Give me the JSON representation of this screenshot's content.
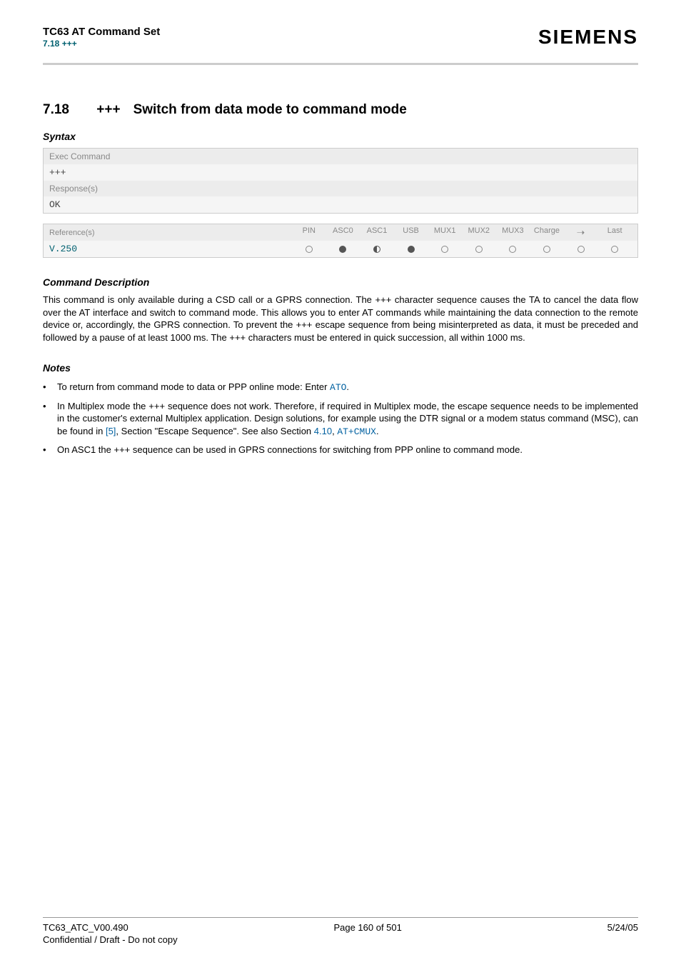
{
  "header": {
    "title": "TC63 AT Command Set",
    "sub": "7.18 +++",
    "brand": "SIEMENS"
  },
  "section": {
    "num": "7.18",
    "plus": "+++",
    "title": "Switch from data mode to command mode"
  },
  "syntax": {
    "heading": "Syntax",
    "exec_label": "Exec Command",
    "exec_cmd": "+++",
    "resp_label": "Response(s)",
    "resp_ok": "OK"
  },
  "ref": {
    "label": "Reference(s)",
    "cols": [
      "PIN",
      "ASC0",
      "ASC1",
      "USB",
      "MUX1",
      "MUX2",
      "MUX3",
      "Charge",
      "➝",
      "Last"
    ],
    "value": "V.250",
    "states": [
      "empty",
      "full",
      "half",
      "full",
      "empty",
      "empty",
      "empty",
      "empty",
      "empty",
      "empty"
    ]
  },
  "cmd_desc": {
    "heading": "Command Description",
    "text": "This command is only available during a CSD call or a GPRS connection. The +++ character sequence causes the TA to cancel the data flow over the AT interface and switch to command mode. This allows you to enter AT commands while maintaining the data connection to the remote device or, accordingly, the GPRS connection. To prevent the +++ escape sequence from being misinterpreted as data, it must be preceded and followed by a pause of at least 1000 ms. The +++ characters must be entered in quick succession, all within 1000 ms."
  },
  "notes": {
    "heading": "Notes",
    "n1_a": "To return from command mode to data or PPP online mode: Enter ",
    "n1_link": "ATO",
    "n1_b": ".",
    "n2_a": "In Multiplex mode the +++ sequence does not work. Therefore, if required in Multiplex mode, the escape sequence needs to be implemented in the customer's external Multiplex application. Design solutions, for example using the DTR signal or a modem status command (MSC), can be found in ",
    "n2_ref": "[5]",
    "n2_b": ", Section \"Escape Sequence\". See also Section ",
    "n2_sec": "4.10",
    "n2_c": ", ",
    "n2_link": "AT+CMUX",
    "n2_d": ".",
    "n3": "On ASC1 the +++ sequence can be used in GPRS connections for switching from PPP online to command mode."
  },
  "footer": {
    "left": "TC63_ATC_V00.490",
    "center": "Page 160 of 501",
    "right": "5/24/05",
    "sub": "Confidential / Draft - Do not copy"
  }
}
